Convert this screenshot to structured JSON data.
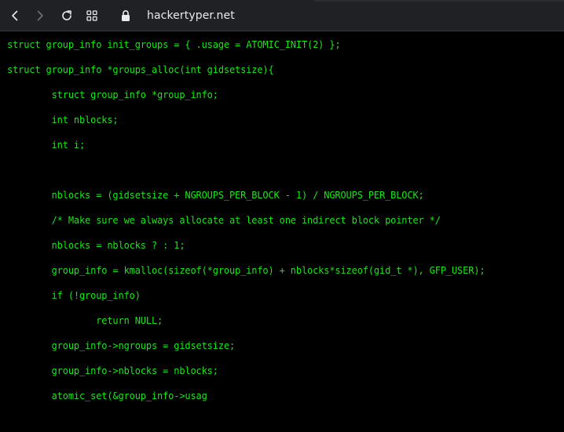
{
  "browser": {
    "url": "hackertyper.net",
    "icons": {
      "back": "chevron-left-icon",
      "forward": "chevron-right-icon",
      "reload": "reload-icon",
      "apps": "apps-grid-icon",
      "lock": "lock-icon"
    }
  },
  "terminal": {
    "text_color": "#19e619",
    "background": "#000000",
    "lines": [
      "struct group_info init_groups = { .usage = ATOMIC_INIT(2) };",
      "struct group_info *groups_alloc(int gidsetsize){",
      "        struct group_info *group_info;",
      "        int nblocks;",
      "        int i;",
      "",
      "        nblocks = (gidsetsize + NGROUPS_PER_BLOCK - 1) / NGROUPS_PER_BLOCK;",
      "        /* Make sure we always allocate at least one indirect block pointer */",
      "        nblocks = nblocks ? : 1;",
      "        group_info = kmalloc(sizeof(*group_info) + nblocks*sizeof(gid_t *), GFP_USER);",
      "        if (!group_info)",
      "                return NULL;",
      "        group_info->ngroups = gidsetsize;",
      "        group_info->nblocks = nblocks;",
      "        atomic_set(&group_info->usag"
    ]
  }
}
